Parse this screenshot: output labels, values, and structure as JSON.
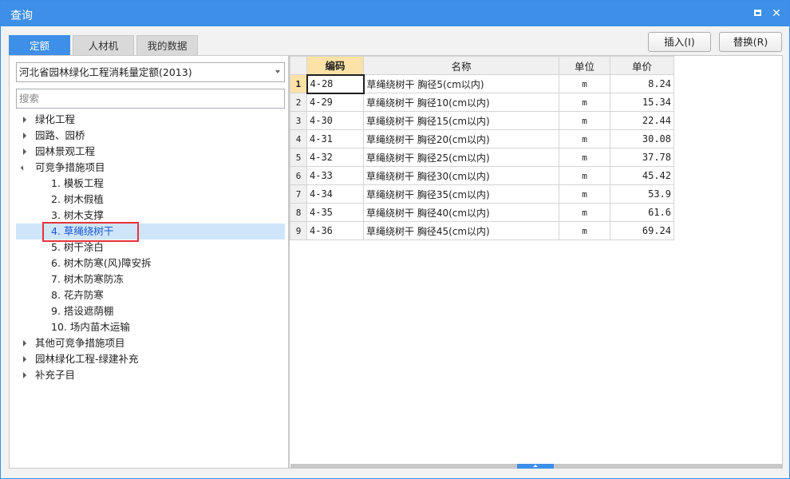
{
  "window": {
    "title": "查询"
  },
  "tabs": [
    "定额",
    "人材机",
    "我的数据"
  ],
  "actions": {
    "insert": "插入(I)",
    "replace": "替换(R)"
  },
  "library": {
    "selected": "河北省园林绿化工程消耗量定额(2013)"
  },
  "search": {
    "placeholder": "搜索"
  },
  "tree": {
    "nodes": [
      {
        "label": "绿化工程",
        "level": 0,
        "expanded": false
      },
      {
        "label": "园路、园桥",
        "level": 0,
        "expanded": false
      },
      {
        "label": "园林景观工程",
        "level": 0,
        "expanded": false
      },
      {
        "label": "可竞争措施项目",
        "level": 0,
        "expanded": true
      },
      {
        "label": "1. 模板工程",
        "level": 1
      },
      {
        "label": "2. 树木假植",
        "level": 1
      },
      {
        "label": "3. 树木支撑",
        "level": 1
      },
      {
        "label": "4. 草绳绕树干",
        "level": 1,
        "selected": true
      },
      {
        "label": "5. 树干涂白",
        "level": 1
      },
      {
        "label": "6. 树木防寒(风)障安拆",
        "level": 1
      },
      {
        "label": "7. 树木防寒防冻",
        "level": 1
      },
      {
        "label": "8. 花卉防寒",
        "level": 1
      },
      {
        "label": "9. 搭设遮荫棚",
        "level": 1
      },
      {
        "label": "10. 场内苗木运输",
        "level": 1
      },
      {
        "label": "其他可竞争措施项目",
        "level": 0,
        "expanded": false
      },
      {
        "label": "园林绿化工程-绿建补充",
        "level": 0,
        "expanded": false
      },
      {
        "label": "补充子目",
        "level": 0,
        "expanded": false
      }
    ]
  },
  "grid": {
    "headers": {
      "code": "编码",
      "name": "名称",
      "unit": "单位",
      "price": "单价"
    },
    "rows": [
      {
        "no": "1",
        "code": "4-28",
        "name": "草绳绕树干 胸径5(cm以内)",
        "unit": "m",
        "price": "8.24"
      },
      {
        "no": "2",
        "code": "4-29",
        "name": "草绳绕树干 胸径10(cm以内)",
        "unit": "m",
        "price": "15.34"
      },
      {
        "no": "3",
        "code": "4-30",
        "name": "草绳绕树干 胸径15(cm以内)",
        "unit": "m",
        "price": "22.44"
      },
      {
        "no": "4",
        "code": "4-31",
        "name": "草绳绕树干 胸径20(cm以内)",
        "unit": "m",
        "price": "30.08"
      },
      {
        "no": "5",
        "code": "4-32",
        "name": "草绳绕树干 胸径25(cm以内)",
        "unit": "m",
        "price": "37.78"
      },
      {
        "no": "6",
        "code": "4-33",
        "name": "草绳绕树干 胸径30(cm以内)",
        "unit": "m",
        "price": "45.42"
      },
      {
        "no": "7",
        "code": "4-34",
        "name": "草绳绕树干 胸径35(cm以内)",
        "unit": "m",
        "price": "53.9"
      },
      {
        "no": "8",
        "code": "4-35",
        "name": "草绳绕树干 胸径40(cm以内)",
        "unit": "m",
        "price": "61.6"
      },
      {
        "no": "9",
        "code": "4-36",
        "name": "草绳绕树干 胸径45(cm以内)",
        "unit": "m",
        "price": "69.24"
      }
    ]
  },
  "colors": {
    "accent": "#3d8fe7",
    "header_highlight": "#fce2a6",
    "selection": "#cfe6fa",
    "annotation": "#e8323c"
  }
}
